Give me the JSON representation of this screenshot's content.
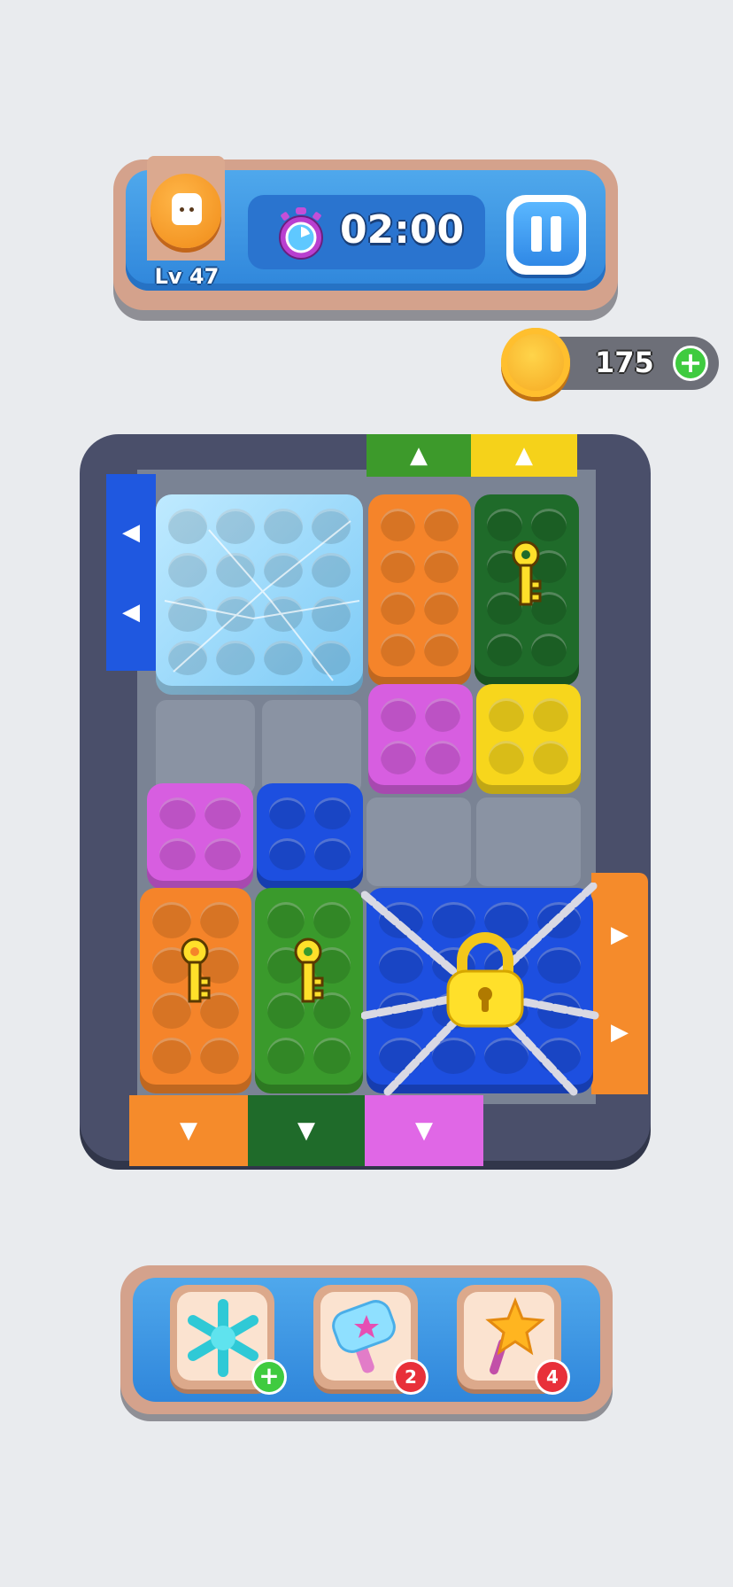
{
  "hud": {
    "level_label": "Lv 47",
    "timer": "02:00",
    "pause_icon": "pause-icon",
    "avatar_icon": "bread-face-icon",
    "timer_icon": "stopwatch-icon"
  },
  "currency": {
    "coins": "175",
    "add_icon": "plus-icon",
    "coin_icon": "coin-icon"
  },
  "board": {
    "exits": [
      {
        "side": "top",
        "color": "#3d9a2b",
        "arrow": "▲"
      },
      {
        "side": "top",
        "color": "#f5d21a",
        "arrow": "▲"
      },
      {
        "side": "left",
        "color": "#1f58e0",
        "arrow": "◀"
      },
      {
        "side": "left",
        "color": "#1f58e0",
        "arrow": "◀"
      },
      {
        "side": "right",
        "color": "#f58b2b",
        "arrow": "▶"
      },
      {
        "side": "right",
        "color": "#f58b2b",
        "arrow": "▶"
      },
      {
        "side": "bottom",
        "color": "#f58b2b",
        "arrow": "▼"
      },
      {
        "side": "bottom",
        "color": "#1f6b2a",
        "arrow": "▼"
      },
      {
        "side": "bottom",
        "color": "#e067e6",
        "arrow": "▼"
      }
    ],
    "blocks": [
      {
        "color": "frozen",
        "state": "frozen"
      },
      {
        "color": "orange"
      },
      {
        "color": "dark-green",
        "has_key": true
      },
      {
        "color": "magenta"
      },
      {
        "color": "yellow"
      },
      {
        "color": "magenta"
      },
      {
        "color": "blue"
      },
      {
        "color": "orange",
        "has_key": true
      },
      {
        "color": "green",
        "has_key": true
      },
      {
        "color": "blue",
        "state": "locked-chained"
      }
    ]
  },
  "boosters": [
    {
      "name": "freeze",
      "icon": "snowflake-icon",
      "badge": "+",
      "badge_color": "#3fcb3f"
    },
    {
      "name": "hammer",
      "icon": "hammer-icon",
      "badge": "2",
      "badge_color": "#e8303a"
    },
    {
      "name": "wand",
      "icon": "star-wand-icon",
      "badge": "4",
      "badge_color": "#e8303a"
    }
  ]
}
